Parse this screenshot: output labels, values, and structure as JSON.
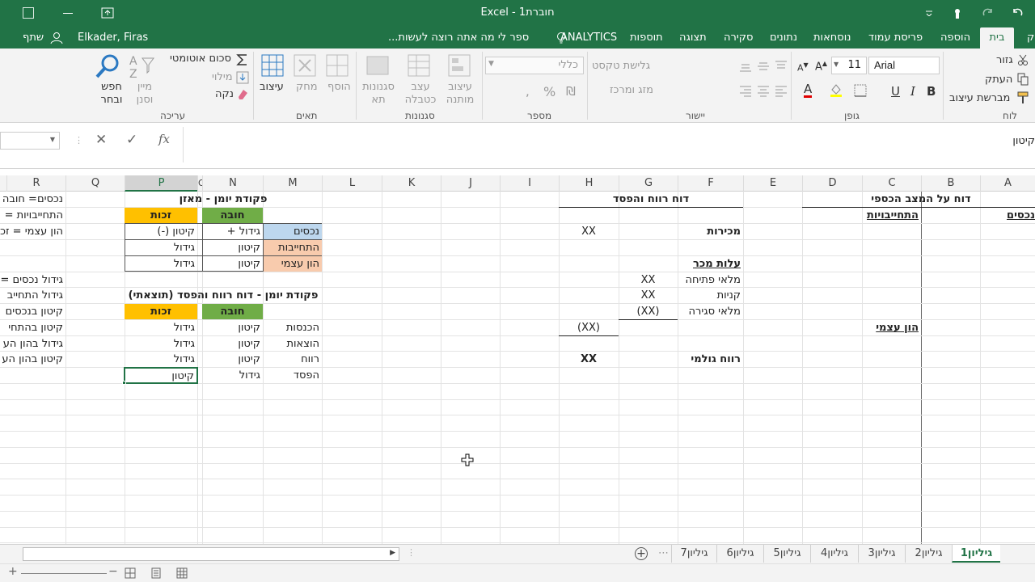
{
  "window": {
    "title": "חוברת1 - Excel"
  },
  "user": {
    "name": "Elkader, Firas",
    "share_label": "שתף"
  },
  "tabs": {
    "partial_right": "ק",
    "home": "בית",
    "insert": "הוספה",
    "page_layout": "פריסת עמוד",
    "formulas": "נוסחאות",
    "data": "נתונים",
    "review": "סקירה",
    "view": "תצוגה",
    "addins": "תוספות",
    "analytics": "ANALYTICS",
    "tellme": "ספר לי מה אתה רוצה לעשות..."
  },
  "ribbon": {
    "clipboard": {
      "cut": "גזור",
      "copy": "העתק",
      "painter": "מברשת עיצוב",
      "group": "לוח"
    },
    "font": {
      "name": "Arial",
      "size": "11",
      "bold": "B",
      "italic": "I",
      "underline": "U",
      "group": "גופן"
    },
    "alignment": {
      "wrap": "גלישת טקסט",
      "merge": "מזג ומרכז",
      "group": "יישור"
    },
    "number": {
      "format": "כללי",
      "percent": "%",
      "group": "מספר"
    },
    "styles": {
      "conditional": "עיצוב מותנה",
      "table": "עצב כטבלה",
      "cell_styles": "סגנונות תא",
      "group": "סגנונות"
    },
    "cells": {
      "insert": "הוסף",
      "delete": "מחק",
      "format": "עיצוב",
      "group": "תאים"
    },
    "editing": {
      "autosum": "סכום אוטומטי",
      "fill": "מילוי",
      "clear": "נקה",
      "sort": "מיין וסנן",
      "find": "חפש ובחר",
      "group": "עריכה"
    }
  },
  "formula_bar": {
    "name_box": "",
    "content": "קיטון"
  },
  "columns": {
    "R": "R",
    "Q": "Q",
    "P": "P",
    "O": "O",
    "N": "N",
    "M": "M",
    "L": "L",
    "K": "K",
    "J": "J",
    "I": "I",
    "H": "H",
    "G": "G",
    "F": "F",
    "E": "E",
    "D": "D",
    "C": "C",
    "B": "B",
    "A": "A"
  },
  "sheet": {
    "r1": {
      "balance_title": "דוח על המצב הכספי",
      "pl_title": "דוח רווח והפסד",
      "journal_title": "פקודת יומן - מאזן",
      "r_text": "נכסים= חובה"
    },
    "r2": {
      "liabilities": "התחייבויות",
      "assets": "נכסים",
      "debit": "חובה",
      "credit": "זכות",
      "r_text": "התחייבויות ="
    },
    "r3": {
      "sales": "מכירות",
      "h": "XX",
      "m": "נכסים",
      "n": "גידול +",
      "p": "קיטון (-)",
      "r_text": "הון עצמי = זכ"
    },
    "r4": {
      "m": "התחייבות",
      "n": "קיטון",
      "p": "גידול"
    },
    "r5": {
      "cogs": "עלות מכר",
      "m": "הון עצמי",
      "n": "קיטון",
      "p": "גידול"
    },
    "r6": {
      "opening": "מלאי פתיחה",
      "g": "XX",
      "r_text": "גידול נכסים ="
    },
    "r7": {
      "purchases": "קניות",
      "g": "XX",
      "journal2_title": "פקודת יומן - דוח רווח והפסד (תוצאתי)",
      "r_text": "גידול התחייב"
    },
    "r8": {
      "closing": "מלאי סגירה",
      "g": "(XX)",
      "debit": "חובה",
      "credit": "זכות",
      "r_text": "קיטון בנכסים"
    },
    "r9": {
      "h": "(XX)",
      "equity": "הון עצמי",
      "m": "הכנסות",
      "n": "קיטון",
      "p": "גידול",
      "r_text": "קיטון בהתחי"
    },
    "r10": {
      "m": "הוצאות",
      "n": "קיטון",
      "p": "גידול",
      "r_text": "גידול בהון הע"
    },
    "r11": {
      "gross": "רווח גולמי",
      "h": "XX",
      "m": "רווח",
      "n": "קיטון",
      "p": "גידול",
      "r_text": "קיטון בהון הע"
    },
    "r12": {
      "m": "הפסד",
      "n": "גידול",
      "p": "קיטון"
    }
  },
  "sheets": [
    "גיליון1",
    "גיליון2",
    "גיליון3",
    "גיליון4",
    "גיליון5",
    "גיליון6",
    "גיליון7"
  ],
  "colors": {
    "excel_green": "#217346",
    "blue_fill": "#bdd7ee",
    "orange_fill": "#f8cbad",
    "green_fill": "#70ad47",
    "gold_fill": "#ffc000"
  }
}
